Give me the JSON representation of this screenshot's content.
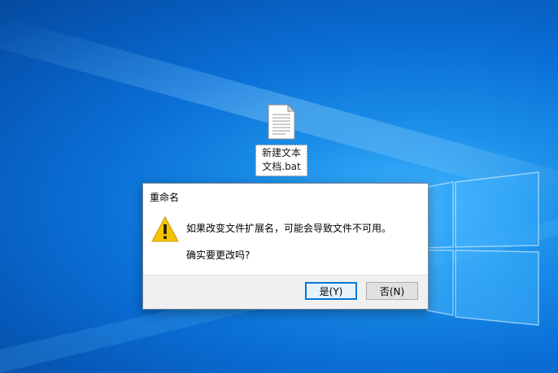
{
  "desktop": {
    "file_icon": {
      "icon": "text-file-icon",
      "label": "新建文本文档.bat"
    }
  },
  "dialog": {
    "title": "重命名",
    "icon": "warning-icon",
    "message_line1": "如果改变文件扩展名，可能会导致文件不可用。",
    "message_line2": "确实要更改吗?",
    "buttons": {
      "yes_label": "是(Y)",
      "no_label": "否(N)"
    }
  },
  "colors": {
    "desktop_blue": "#0a6fd6",
    "button_focus": "#0078d7",
    "warning_yellow": "#f5c400"
  }
}
